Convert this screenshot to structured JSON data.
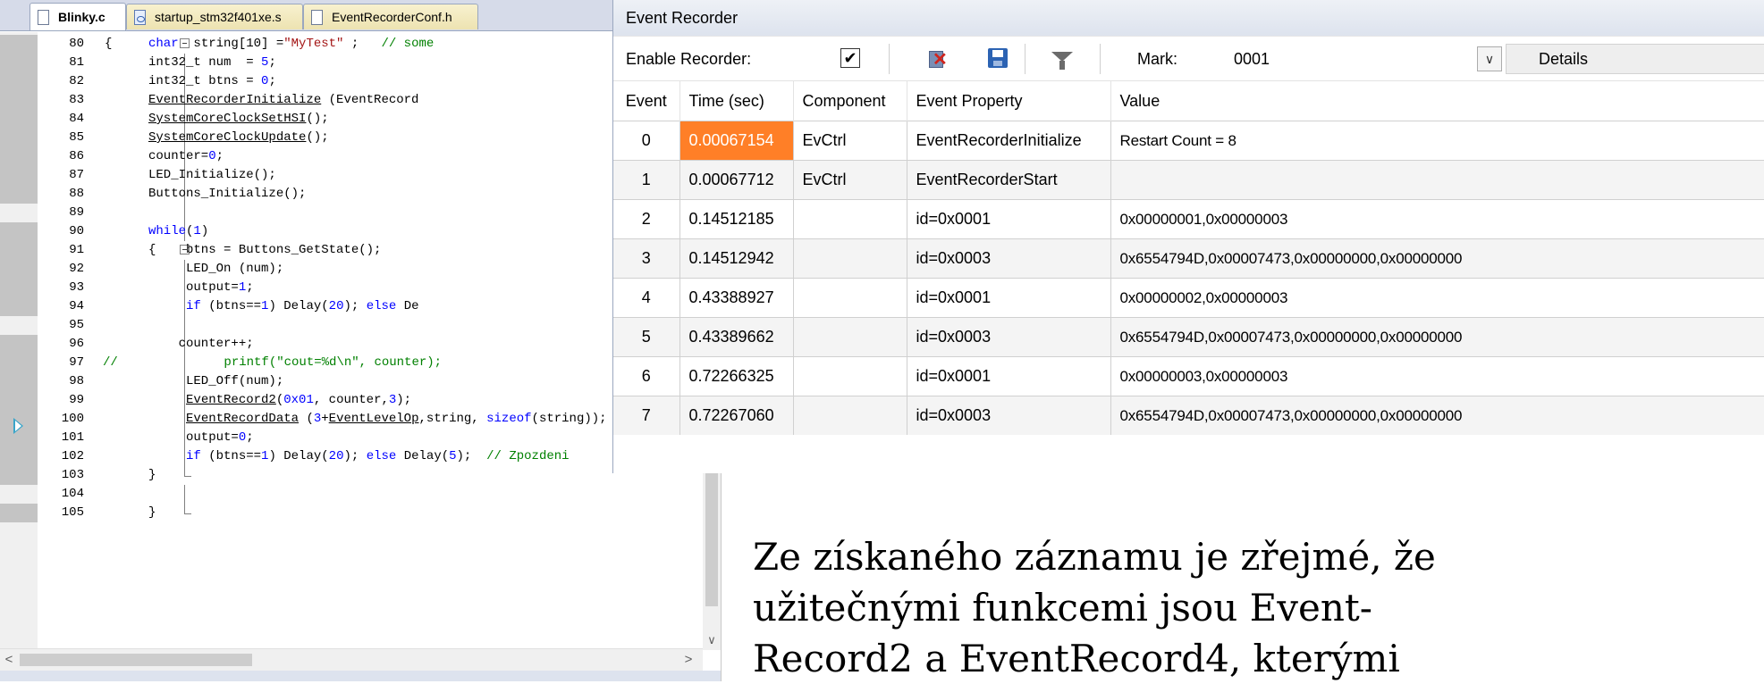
{
  "editor": {
    "tabs": [
      {
        "label": "Blinky.c",
        "icon": "c-file-icon",
        "active": true
      },
      {
        "label": "startup_stm32f401xe.s",
        "icon": "asm-file-icon",
        "active": false
      },
      {
        "label": "EventRecorderConf.h",
        "icon": "h-file-icon",
        "active": false
      }
    ],
    "lines": [
      {
        "n": "80",
        "segs": [
          [
            "kw",
            "char"
          ],
          [
            "",
            "  string[10] ="
          ],
          [
            "str",
            "\"MyTest\""
          ],
          [
            "",
            " ;   "
          ],
          [
            "cmt",
            "// some"
          ]
        ]
      },
      {
        "n": "81",
        "segs": [
          [
            "",
            "int32_t num  = "
          ],
          [
            "num",
            "5"
          ],
          [
            "",
            ";"
          ]
        ]
      },
      {
        "n": "82",
        "segs": [
          [
            "",
            "int32_t btns = "
          ],
          [
            "num",
            "0"
          ],
          [
            "",
            ";"
          ]
        ]
      },
      {
        "n": "83",
        "segs": [
          [
            "fn",
            "EventRecorderInitialize"
          ],
          [
            "",
            " (EventRecord"
          ]
        ]
      },
      {
        "n": "84",
        "segs": [
          [
            "fn",
            "SystemCoreClockSetHSI"
          ],
          [
            "",
            "();"
          ]
        ]
      },
      {
        "n": "85",
        "segs": [
          [
            "fn",
            "SystemCoreClockUpdate"
          ],
          [
            "",
            "();"
          ]
        ]
      },
      {
        "n": "86",
        "segs": [
          [
            "",
            "counter="
          ],
          [
            "num",
            "0"
          ],
          [
            "",
            ";"
          ]
        ]
      },
      {
        "n": "87",
        "segs": [
          [
            "",
            "LED_Initialize();"
          ]
        ]
      },
      {
        "n": "88",
        "segs": [
          [
            "",
            "Buttons_Initialize();"
          ]
        ]
      },
      {
        "n": "89",
        "segs": []
      },
      {
        "n": "90",
        "segs": [
          [
            "kw",
            "while"
          ],
          [
            "",
            "("
          ],
          [
            "num",
            "1"
          ],
          [
            "",
            ")"
          ]
        ]
      },
      {
        "n": "91",
        "segs": [
          [
            "",
            "{    btns = Buttons_GetState();"
          ]
        ]
      },
      {
        "n": "92",
        "segs": [
          [
            "",
            "     LED_On (num);"
          ]
        ]
      },
      {
        "n": "93",
        "segs": [
          [
            "",
            "     output="
          ],
          [
            "num",
            "1"
          ],
          [
            "",
            ";"
          ]
        ]
      },
      {
        "n": "94",
        "segs": [
          [
            "",
            "     "
          ],
          [
            "kw",
            "if"
          ],
          [
            "",
            " (btns=="
          ],
          [
            "num",
            "1"
          ],
          [
            "",
            ") Delay("
          ],
          [
            "num",
            "20"
          ],
          [
            "",
            "); "
          ],
          [
            "kw",
            "else"
          ],
          [
            "",
            " De"
          ]
        ]
      },
      {
        "n": "95",
        "segs": []
      },
      {
        "n": "96",
        "segs": [
          [
            "",
            "    counter++;"
          ]
        ]
      },
      {
        "n": "97",
        "segs": [
          [
            "",
            "      "
          ],
          [
            "cmt",
            "printf(\"cout=%d\\n\", counter);"
          ]
        ]
      },
      {
        "n": "98",
        "segs": [
          [
            "",
            "     LED_Off(num);"
          ]
        ]
      },
      {
        "n": "99",
        "segs": [
          [
            "",
            "     "
          ],
          [
            "fn",
            "EventRecord2"
          ],
          [
            "",
            "("
          ],
          [
            "num",
            "0x01"
          ],
          [
            "",
            ", counter,"
          ],
          [
            "num",
            "3"
          ],
          [
            "",
            ");"
          ]
        ]
      },
      {
        "n": "100",
        "segs": [
          [
            "",
            "     "
          ],
          [
            "fn",
            "EventRecordData"
          ],
          [
            "",
            " ("
          ],
          [
            "num",
            "3"
          ],
          [
            "",
            "+"
          ],
          [
            "fn",
            "EventLevelOp"
          ],
          [
            "",
            ",string, "
          ],
          [
            "kw",
            "sizeof"
          ],
          [
            "",
            "(string));"
          ]
        ]
      },
      {
        "n": "101",
        "segs": [
          [
            "",
            "     output="
          ],
          [
            "num",
            "0"
          ],
          [
            "",
            ";"
          ]
        ]
      },
      {
        "n": "102",
        "segs": [
          [
            "",
            "     "
          ],
          [
            "kw",
            "if"
          ],
          [
            "",
            " (btns=="
          ],
          [
            "num",
            "1"
          ],
          [
            "",
            ") Delay("
          ],
          [
            "num",
            "20"
          ],
          [
            "",
            "); "
          ],
          [
            "kw",
            "else"
          ],
          [
            "",
            " Delay("
          ],
          [
            "num",
            "5"
          ],
          [
            "",
            ");  "
          ],
          [
            "cmt",
            "// Zpozdeni"
          ]
        ]
      },
      {
        "n": "103",
        "segs": [
          [
            "",
            "}"
          ]
        ]
      },
      {
        "n": "104",
        "segs": []
      },
      {
        "n": "105",
        "segs": [
          [
            "",
            "}"
          ]
        ]
      }
    ],
    "comment_prefix_97": "//",
    "fold_open_80": "{",
    "fold_open_91": "",
    "scroll_left": "<",
    "scroll_right": ">",
    "scroll_down": "∨"
  },
  "recorder": {
    "title": "Event Recorder",
    "enable_label": "Enable Recorder:",
    "enable_checked": "✔",
    "mark_label": "Mark:",
    "mark_value": "0001",
    "details_label": "Details",
    "dropdown_glyph": "∨",
    "columns": [
      "Event",
      "Time (sec)",
      "Component",
      "Event Property",
      "Value"
    ],
    "rows": [
      {
        "event": "0",
        "time": "0.00067154",
        "component": "EvCtrl",
        "property": "EventRecorderInitialize",
        "value": "Restart Count = 8"
      },
      {
        "event": "1",
        "time": "0.00067712",
        "component": "EvCtrl",
        "property": "EventRecorderStart",
        "value": ""
      },
      {
        "event": "2",
        "time": "0.14512185",
        "component": "",
        "property": "id=0x0001",
        "value": "0x00000001,0x00000003"
      },
      {
        "event": "3",
        "time": "0.14512942",
        "component": "",
        "property": "id=0x0003",
        "value": "0x6554794D,0x00007473,0x00000000,0x00000000"
      },
      {
        "event": "4",
        "time": "0.43388927",
        "component": "",
        "property": "id=0x0001",
        "value": "0x00000002,0x00000003"
      },
      {
        "event": "5",
        "time": "0.43389662",
        "component": "",
        "property": "id=0x0003",
        "value": "0x6554794D,0x00007473,0x00000000,0x00000000"
      },
      {
        "event": "6",
        "time": "0.72266325",
        "component": "",
        "property": "id=0x0001",
        "value": "0x00000003,0x00000003"
      },
      {
        "event": "7",
        "time": "0.72267060",
        "component": "",
        "property": "id=0x0003",
        "value": "0x6554794D,0x00007473,0x00000000,0x00000000"
      }
    ],
    "highlight_color": "#ff7f27"
  },
  "caption": {
    "lines": [
      "Ze získaného záznamu je zřejmé, že",
      "užitečnými funkcemi jsou Event-",
      "Record2 a EventRecord4, kterými"
    ]
  }
}
